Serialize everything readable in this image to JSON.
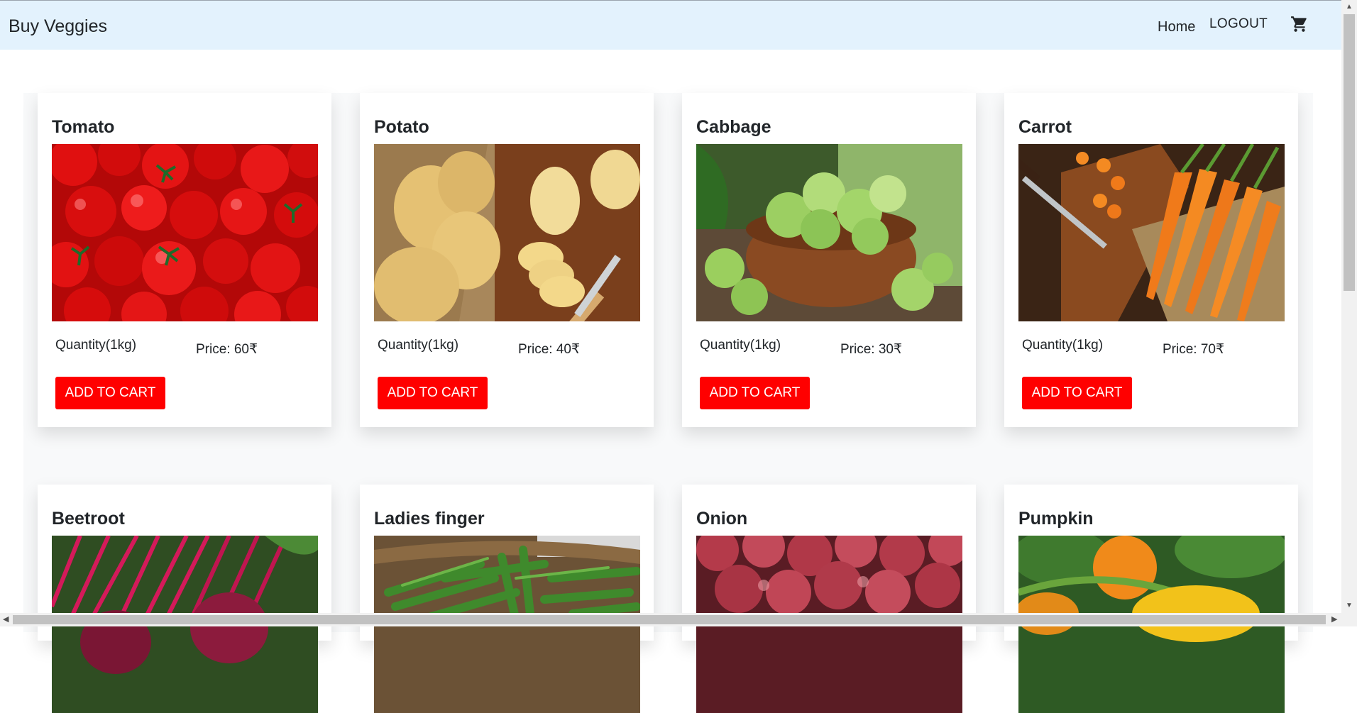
{
  "nav": {
    "brand": "Buy Veggies",
    "home": "Home",
    "logout": "LOGOUT",
    "cart_icon": "shopping-cart-icon"
  },
  "products": [
    {
      "name": "Tomato",
      "quantity": "Quantity(1kg)",
      "price": "Price: 60₹",
      "button": "ADD TO CART"
    },
    {
      "name": "Potato",
      "quantity": "Quantity(1kg)",
      "price": "Price: 40₹",
      "button": "ADD TO CART"
    },
    {
      "name": "Cabbage",
      "quantity": "Quantity(1kg)",
      "price": "Price: 30₹",
      "button": "ADD TO CART"
    },
    {
      "name": "Carrot",
      "quantity": "Quantity(1kg)",
      "price": "Price: 70₹",
      "button": "ADD TO CART"
    },
    {
      "name": "Beetroot"
    },
    {
      "name": "Ladies finger"
    },
    {
      "name": "Onion"
    },
    {
      "name": "Pumpkin"
    }
  ],
  "colors": {
    "navbar": "#e3f2fd",
    "button": "#ff0000",
    "button_text": "#ffffff"
  }
}
